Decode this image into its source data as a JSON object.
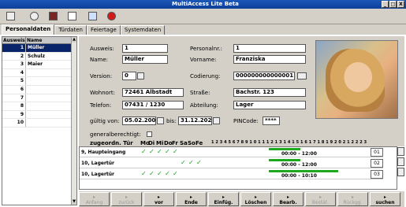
{
  "window": {
    "title": "MultiAccess Lite Beta",
    "controls": [
      "_",
      "□",
      "X"
    ]
  },
  "toolbar": {
    "icons": [
      "layout-icon",
      "settings-icon",
      "book-icon",
      "document-icon",
      "network-icon",
      "stop-icon"
    ]
  },
  "tabs": [
    "Personaldaten",
    "Türdaten",
    "Feiertage",
    "Systemdaten"
  ],
  "active_tab": "Personaldaten",
  "sidebar": {
    "headers": [
      "Ausweis",
      "Name"
    ],
    "rows": [
      {
        "n": "1",
        "name": "Müller"
      },
      {
        "n": "2",
        "name": "Schulz"
      },
      {
        "n": "3",
        "name": "Maier"
      },
      {
        "n": "4",
        "name": ""
      },
      {
        "n": "5",
        "name": ""
      },
      {
        "n": "6",
        "name": ""
      },
      {
        "n": "7",
        "name": ""
      },
      {
        "n": "8",
        "name": ""
      },
      {
        "n": "9",
        "name": ""
      },
      {
        "n": "10",
        "name": ""
      }
    ]
  },
  "form": {
    "ausweis_label": "Ausweis:",
    "ausweis": "1",
    "personalnr_label": "Personalnr.:",
    "personalnr": "1",
    "name_label": "Name:",
    "name": "Müller",
    "vorname_label": "Vorname:",
    "vorname": "Franziska",
    "version_label": "Version:",
    "version": "0",
    "codierung_label": "Codierung:",
    "codierung": "000000000000001",
    "wohnort_label": "Wohnort:",
    "wohnort": "72461 Albstadt",
    "strasse_label": "Straße:",
    "strasse": "Bachstr. 123",
    "telefon_label": "Telefon:",
    "telefon": "07431 / 1230",
    "abteilung_label": "Abteilung:",
    "abteilung": "Lager",
    "gueltig_label": "gültig von:",
    "gueltig_von": "05.02.2004",
    "bis_label": "bis:",
    "bis": "31.12.2025",
    "pincode_label": "PINCode:",
    "pincode": "****",
    "generalberechtigt_label": "generalberechtigt:"
  },
  "schedule": {
    "door_header": "zugeordn. Tür",
    "days": [
      "Mo",
      "Di",
      "Mi",
      "Do",
      "Fr",
      "Sa",
      "So",
      "Fe"
    ],
    "rows": [
      {
        "door": "9, Haupteingang",
        "num": "01",
        "checks": [
          1,
          1,
          1,
          1,
          1,
          0,
          0,
          0
        ],
        "time1": "00:00 - 12:00",
        "time2": ""
      },
      {
        "door": "10, Lagertür",
        "num": "02",
        "checks": [
          0,
          0,
          0,
          0,
          0,
          1,
          1,
          1
        ],
        "time1": "00:00 - 12:00",
        "time2": ""
      },
      {
        "door": "10, Lagertür",
        "num": "03",
        "checks": [
          1,
          1,
          1,
          1,
          1,
          0,
          0,
          0
        ],
        "time1": "00:00 - 10:10",
        "time2": ""
      }
    ]
  },
  "navigation": [
    {
      "label": "Anfang",
      "enabled": false
    },
    {
      "label": "zurück",
      "enabled": false
    },
    {
      "label": "vor",
      "enabled": true
    },
    {
      "label": "Ende",
      "enabled": true
    },
    {
      "label": "Einfüg.",
      "enabled": true
    },
    {
      "label": "Löschen",
      "enabled": true
    },
    {
      "label": "Bearb.",
      "enabled": true
    },
    {
      "label": "Bestät.",
      "enabled": false
    },
    {
      "label": "Rückgg.",
      "enabled": false
    },
    {
      "label": "suchen",
      "enabled": true
    }
  ]
}
